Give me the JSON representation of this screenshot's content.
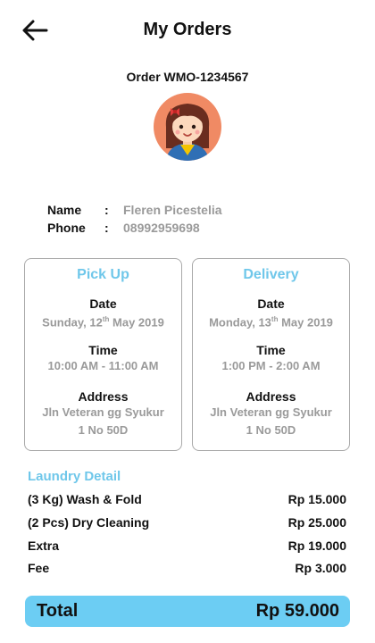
{
  "header": {
    "title": "My Orders",
    "back_icon": "arrow-left-icon"
  },
  "order": {
    "id_text": "Order WMO-1234567",
    "avatar_icon": "girl-avatar-icon"
  },
  "customer": {
    "name_label": "Name",
    "name_value": "Fleren Picestelia",
    "phone_label": "Phone",
    "phone_value": "08992959698",
    "separator": ":"
  },
  "pickup": {
    "title": "Pick Up",
    "date_label": "Date",
    "date_value": [
      "Sunday, 12",
      "th",
      " May 2019"
    ],
    "time_label": "Time",
    "time_value": "10:00 AM - 11:00 AM",
    "address_label": "Address",
    "address_line1": "Jln Veteran gg Syukur",
    "address_line2": "1 No 50D"
  },
  "delivery": {
    "title": "Delivery",
    "date_value": [
      "Monday, 13",
      "th",
      " May 2019"
    ],
    "date_label": "Date",
    "time_label": "Time",
    "time_value": "1:00 PM - 2:00 AM",
    "address_label": "Address",
    "address_line1": "Jln Veteran gg Syukur",
    "address_line2": "1 No 50D"
  },
  "laundry": {
    "title": "Laundry Detail",
    "items": [
      {
        "name": "(3 Kg) Wash & Fold",
        "price": "Rp 15.000"
      },
      {
        "name": "(2 Pcs) Dry Cleaning",
        "price": "Rp 25.000"
      },
      {
        "name": "Extra",
        "price": "Rp 19.000"
      },
      {
        "name": "Fee",
        "price": "Rp 3.000"
      }
    ]
  },
  "total": {
    "label": "Total",
    "value": "Rp 59.000"
  },
  "colors": {
    "accent": "#6fc7ea",
    "total_bar": "#6ccdf3",
    "muted_text": "#9a9a9a",
    "avatar_bg": "#f08a64"
  }
}
